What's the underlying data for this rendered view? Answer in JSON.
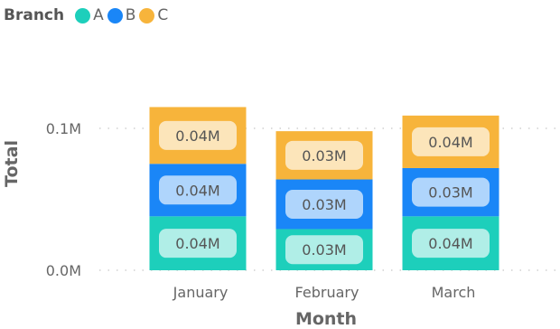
{
  "chart_data": {
    "type": "bar",
    "stacked": true,
    "legend": {
      "title": "Branch",
      "position": "top-left"
    },
    "xlabel": "Month",
    "ylabel": "Total",
    "categories": [
      "January",
      "February",
      "March"
    ],
    "series": [
      {
        "name": "A",
        "color": "#1dcfbb",
        "values": [
          0.038,
          0.029,
          0.038
        ],
        "labels": [
          "0.04M",
          "0.03M",
          "0.04M"
        ]
      },
      {
        "name": "B",
        "color": "#1a86f7",
        "values": [
          0.037,
          0.035,
          0.034
        ],
        "labels": [
          "0.04M",
          "0.03M",
          "0.03M"
        ]
      },
      {
        "name": "C",
        "color": "#f7b43b",
        "values": [
          0.04,
          0.034,
          0.037
        ],
        "labels": [
          "0.04M",
          "0.03M",
          "0.04M"
        ]
      }
    ],
    "y_ticks": [
      {
        "value": 0,
        "label": "0.0M"
      },
      {
        "value": 0.1,
        "label": "0.1M"
      }
    ],
    "ylim": [
      0,
      0.1
    ],
    "grid": true
  }
}
